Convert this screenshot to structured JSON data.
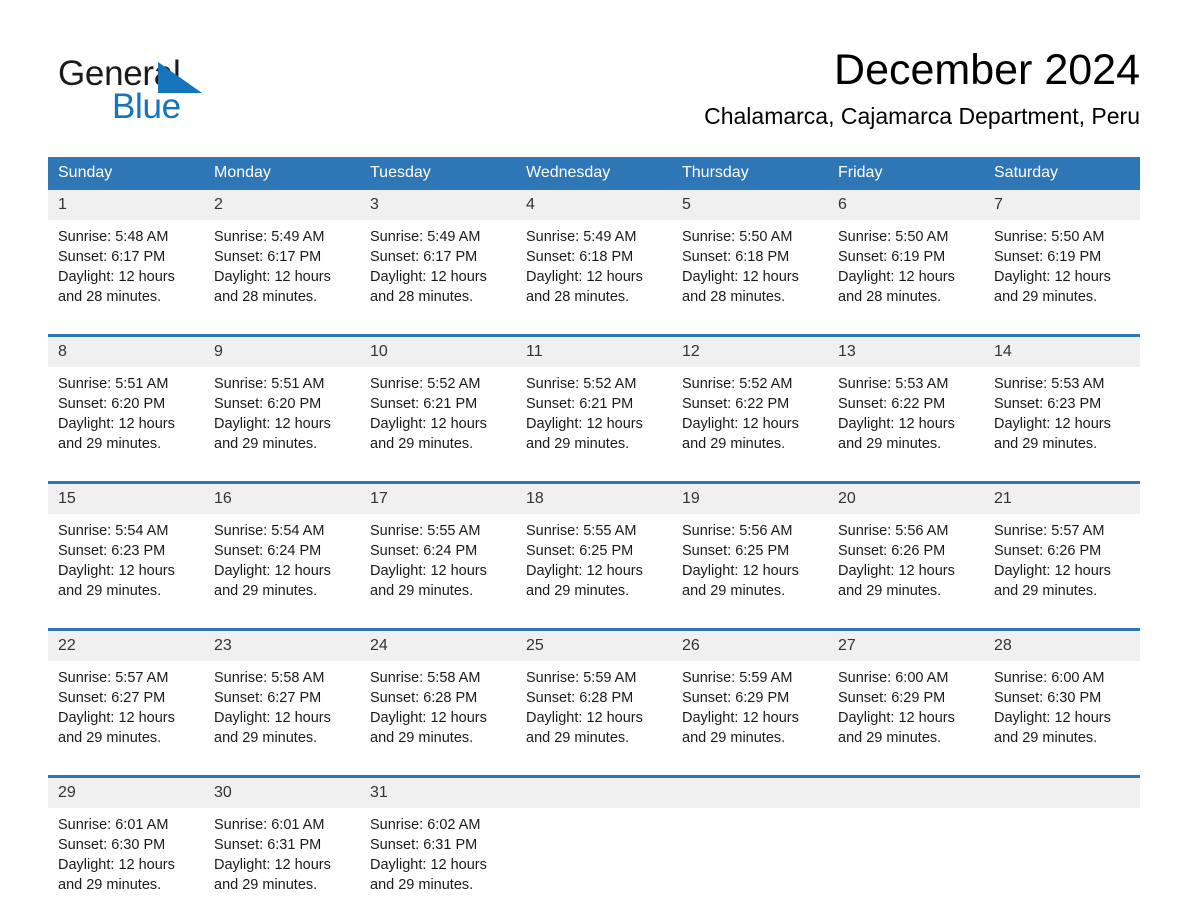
{
  "brand": {
    "word_one": "General",
    "word_two": "Blue",
    "triangle_icon": "triangle-icon",
    "accent_color": "#1574bb"
  },
  "header": {
    "month_title": "December 2024",
    "location": "Chalamarca, Cajamarca Department, Peru"
  },
  "calendar": {
    "header_color": "#2e76b6",
    "daynum_bg": "#f0f0f0",
    "weekday_headers": [
      "Sunday",
      "Monday",
      "Tuesday",
      "Wednesday",
      "Thursday",
      "Friday",
      "Saturday"
    ],
    "weeks": [
      [
        {
          "day": "1",
          "sunrise": "Sunrise: 5:48 AM",
          "sunset": "Sunset: 6:17 PM",
          "daylight_line1": "Daylight: 12 hours",
          "daylight_line2": "and 28 minutes."
        },
        {
          "day": "2",
          "sunrise": "Sunrise: 5:49 AM",
          "sunset": "Sunset: 6:17 PM",
          "daylight_line1": "Daylight: 12 hours",
          "daylight_line2": "and 28 minutes."
        },
        {
          "day": "3",
          "sunrise": "Sunrise: 5:49 AM",
          "sunset": "Sunset: 6:17 PM",
          "daylight_line1": "Daylight: 12 hours",
          "daylight_line2": "and 28 minutes."
        },
        {
          "day": "4",
          "sunrise": "Sunrise: 5:49 AM",
          "sunset": "Sunset: 6:18 PM",
          "daylight_line1": "Daylight: 12 hours",
          "daylight_line2": "and 28 minutes."
        },
        {
          "day": "5",
          "sunrise": "Sunrise: 5:50 AM",
          "sunset": "Sunset: 6:18 PM",
          "daylight_line1": "Daylight: 12 hours",
          "daylight_line2": "and 28 minutes."
        },
        {
          "day": "6",
          "sunrise": "Sunrise: 5:50 AM",
          "sunset": "Sunset: 6:19 PM",
          "daylight_line1": "Daylight: 12 hours",
          "daylight_line2": "and 28 minutes."
        },
        {
          "day": "7",
          "sunrise": "Sunrise: 5:50 AM",
          "sunset": "Sunset: 6:19 PM",
          "daylight_line1": "Daylight: 12 hours",
          "daylight_line2": "and 29 minutes."
        }
      ],
      [
        {
          "day": "8",
          "sunrise": "Sunrise: 5:51 AM",
          "sunset": "Sunset: 6:20 PM",
          "daylight_line1": "Daylight: 12 hours",
          "daylight_line2": "and 29 minutes."
        },
        {
          "day": "9",
          "sunrise": "Sunrise: 5:51 AM",
          "sunset": "Sunset: 6:20 PM",
          "daylight_line1": "Daylight: 12 hours",
          "daylight_line2": "and 29 minutes."
        },
        {
          "day": "10",
          "sunrise": "Sunrise: 5:52 AM",
          "sunset": "Sunset: 6:21 PM",
          "daylight_line1": "Daylight: 12 hours",
          "daylight_line2": "and 29 minutes."
        },
        {
          "day": "11",
          "sunrise": "Sunrise: 5:52 AM",
          "sunset": "Sunset: 6:21 PM",
          "daylight_line1": "Daylight: 12 hours",
          "daylight_line2": "and 29 minutes."
        },
        {
          "day": "12",
          "sunrise": "Sunrise: 5:52 AM",
          "sunset": "Sunset: 6:22 PM",
          "daylight_line1": "Daylight: 12 hours",
          "daylight_line2": "and 29 minutes."
        },
        {
          "day": "13",
          "sunrise": "Sunrise: 5:53 AM",
          "sunset": "Sunset: 6:22 PM",
          "daylight_line1": "Daylight: 12 hours",
          "daylight_line2": "and 29 minutes."
        },
        {
          "day": "14",
          "sunrise": "Sunrise: 5:53 AM",
          "sunset": "Sunset: 6:23 PM",
          "daylight_line1": "Daylight: 12 hours",
          "daylight_line2": "and 29 minutes."
        }
      ],
      [
        {
          "day": "15",
          "sunrise": "Sunrise: 5:54 AM",
          "sunset": "Sunset: 6:23 PM",
          "daylight_line1": "Daylight: 12 hours",
          "daylight_line2": "and 29 minutes."
        },
        {
          "day": "16",
          "sunrise": "Sunrise: 5:54 AM",
          "sunset": "Sunset: 6:24 PM",
          "daylight_line1": "Daylight: 12 hours",
          "daylight_line2": "and 29 minutes."
        },
        {
          "day": "17",
          "sunrise": "Sunrise: 5:55 AM",
          "sunset": "Sunset: 6:24 PM",
          "daylight_line1": "Daylight: 12 hours",
          "daylight_line2": "and 29 minutes."
        },
        {
          "day": "18",
          "sunrise": "Sunrise: 5:55 AM",
          "sunset": "Sunset: 6:25 PM",
          "daylight_line1": "Daylight: 12 hours",
          "daylight_line2": "and 29 minutes."
        },
        {
          "day": "19",
          "sunrise": "Sunrise: 5:56 AM",
          "sunset": "Sunset: 6:25 PM",
          "daylight_line1": "Daylight: 12 hours",
          "daylight_line2": "and 29 minutes."
        },
        {
          "day": "20",
          "sunrise": "Sunrise: 5:56 AM",
          "sunset": "Sunset: 6:26 PM",
          "daylight_line1": "Daylight: 12 hours",
          "daylight_line2": "and 29 minutes."
        },
        {
          "day": "21",
          "sunrise": "Sunrise: 5:57 AM",
          "sunset": "Sunset: 6:26 PM",
          "daylight_line1": "Daylight: 12 hours",
          "daylight_line2": "and 29 minutes."
        }
      ],
      [
        {
          "day": "22",
          "sunrise": "Sunrise: 5:57 AM",
          "sunset": "Sunset: 6:27 PM",
          "daylight_line1": "Daylight: 12 hours",
          "daylight_line2": "and 29 minutes."
        },
        {
          "day": "23",
          "sunrise": "Sunrise: 5:58 AM",
          "sunset": "Sunset: 6:27 PM",
          "daylight_line1": "Daylight: 12 hours",
          "daylight_line2": "and 29 minutes."
        },
        {
          "day": "24",
          "sunrise": "Sunrise: 5:58 AM",
          "sunset": "Sunset: 6:28 PM",
          "daylight_line1": "Daylight: 12 hours",
          "daylight_line2": "and 29 minutes."
        },
        {
          "day": "25",
          "sunrise": "Sunrise: 5:59 AM",
          "sunset": "Sunset: 6:28 PM",
          "daylight_line1": "Daylight: 12 hours",
          "daylight_line2": "and 29 minutes."
        },
        {
          "day": "26",
          "sunrise": "Sunrise: 5:59 AM",
          "sunset": "Sunset: 6:29 PM",
          "daylight_line1": "Daylight: 12 hours",
          "daylight_line2": "and 29 minutes."
        },
        {
          "day": "27",
          "sunrise": "Sunrise: 6:00 AM",
          "sunset": "Sunset: 6:29 PM",
          "daylight_line1": "Daylight: 12 hours",
          "daylight_line2": "and 29 minutes."
        },
        {
          "day": "28",
          "sunrise": "Sunrise: 6:00 AM",
          "sunset": "Sunset: 6:30 PM",
          "daylight_line1": "Daylight: 12 hours",
          "daylight_line2": "and 29 minutes."
        }
      ],
      [
        {
          "day": "29",
          "sunrise": "Sunrise: 6:01 AM",
          "sunset": "Sunset: 6:30 PM",
          "daylight_line1": "Daylight: 12 hours",
          "daylight_line2": "and 29 minutes."
        },
        {
          "day": "30",
          "sunrise": "Sunrise: 6:01 AM",
          "sunset": "Sunset: 6:31 PM",
          "daylight_line1": "Daylight: 12 hours",
          "daylight_line2": "and 29 minutes."
        },
        {
          "day": "31",
          "sunrise": "Sunrise: 6:02 AM",
          "sunset": "Sunset: 6:31 PM",
          "daylight_line1": "Daylight: 12 hours",
          "daylight_line2": "and 29 minutes."
        },
        {
          "day": "",
          "sunrise": "",
          "sunset": "",
          "daylight_line1": "",
          "daylight_line2": ""
        },
        {
          "day": "",
          "sunrise": "",
          "sunset": "",
          "daylight_line1": "",
          "daylight_line2": ""
        },
        {
          "day": "",
          "sunrise": "",
          "sunset": "",
          "daylight_line1": "",
          "daylight_line2": ""
        },
        {
          "day": "",
          "sunrise": "",
          "sunset": "",
          "daylight_line1": "",
          "daylight_line2": ""
        }
      ]
    ]
  }
}
